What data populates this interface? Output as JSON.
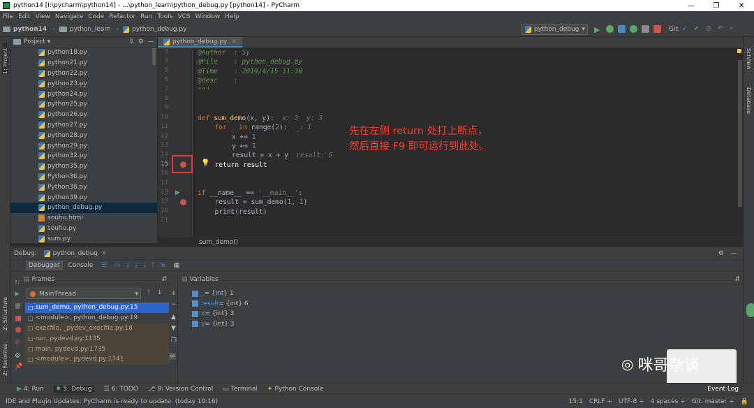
{
  "window": {
    "title": "python14 [I:\\pycharm\\python14] - ...\\python_learn\\python_debug.py [python14] - PyCharm",
    "minimize": "—",
    "maximize": "❐",
    "close": "✕"
  },
  "menu": [
    "File",
    "Edit",
    "View",
    "Navigate",
    "Code",
    "Refactor",
    "Run",
    "Tools",
    "VCS",
    "Window",
    "Help"
  ],
  "breadcrumbs": [
    "python14",
    "python_learn",
    "python_debug.py"
  ],
  "run_config": "python_debug",
  "git_label": "Git:",
  "left_strip": {
    "project": "1: Project",
    "structure": "Z: Structure",
    "favorites": "2: Favorites"
  },
  "right_strip": {
    "sciview": "SciView",
    "database": "Database"
  },
  "project_panel": {
    "title": "Project",
    "files": [
      "python18.py",
      "python21.py",
      "python22.py",
      "python23.py",
      "python24.py",
      "python25.py",
      "python26.py",
      "python27.py",
      "python28.py",
      "python29.py",
      "python32.py",
      "python35.py",
      "Python36.py",
      "Python38.py",
      "python39.py",
      "python_debug.py",
      "souhu.html",
      "souhu.py",
      "sum.py"
    ]
  },
  "editor": {
    "tab": "python_debug.py",
    "line_numbers": [
      "3",
      "4",
      "5",
      "6",
      "7",
      "8",
      "9",
      "10",
      "11",
      "12",
      "13",
      "14",
      "15",
      "16",
      "17",
      "18",
      "19",
      "20",
      "21"
    ],
    "breadcrumb": "sum_demo()",
    "code": {
      "l3_key": "@Author",
      "l3_val": "  : Sy",
      "l4_key": "@File",
      "l4_val": "    : python_debug.py",
      "l5_key": "@Time",
      "l5_val": "    : 2019/4/15 11:30",
      "l6_key": "@desc",
      "l6_val": "    :",
      "l7": "\"\"\"",
      "l10_def": "def ",
      "l10_fn": "sum_demo",
      "l10_args": "(x, y):",
      "l10_inline": "  x: 3  y: 3",
      "l11_for": "for ",
      "l11_mid": "_ ",
      "l11_in": "in ",
      "l11_range": "range(",
      "l11_num": "2",
      "l11_end": "):",
      "l11_inline": "  _: 1",
      "l12_a": "x += ",
      "l12_num": "1",
      "l13_a": "y += ",
      "l13_num": "1",
      "l14_a": "result = x + y",
      "l14_inline": "  result: 6",
      "l15_kw": "return ",
      "l15_rest": "result",
      "l18_if": "if ",
      "l18_mid": "__name__ == ",
      "l18_str": "'__main__'",
      "l18_end": ":",
      "l19_a": "result = sum_demo(",
      "l19_n1": "1",
      "l19_sep": ", ",
      "l19_n2": "1",
      "l19_end": ")",
      "l20": "print(result)"
    }
  },
  "annotation": {
    "line1": "先在左侧 return 处打上断点，",
    "line2": "然后直接 F9 即可运行到此处。"
  },
  "debug": {
    "label": "Debug:",
    "config": "python_debug",
    "tabs": [
      "Debugger",
      "Console"
    ],
    "frames_title": "Frames",
    "thread": "MainThread",
    "frames": [
      {
        "text": "sum_demo, python_debug.py:15",
        "kind": "sel"
      },
      {
        "text": "<module>, python_debug.py:19",
        "kind": "user"
      },
      {
        "text": "execfile, _pydev_execfile.py:18",
        "kind": "lib"
      },
      {
        "text": "run, pydevd.py:1135",
        "kind": "lib"
      },
      {
        "text": "main, pydevd.py:1735",
        "kind": "lib"
      },
      {
        "text": "<module>, pydevd.py:1741",
        "kind": "lib"
      }
    ],
    "variables_title": "Variables",
    "variables": [
      {
        "name": "_",
        "value": " = {int} 1"
      },
      {
        "name": "result",
        "value": " = {int} 6"
      },
      {
        "name": "x",
        "value": " = {int} 3"
      },
      {
        "name": "y",
        "value": " = {int} 3"
      }
    ]
  },
  "bottom_tabs": [
    "4: Run",
    "5: Debug",
    "6: TODO",
    "9: Version Control",
    "Terminal",
    "Python Console"
  ],
  "event_log": "Event Log",
  "status": {
    "message": "IDE and Plugin Updates: PyCharm is ready to update. (today 10:16)",
    "position": "15:1",
    "line_sep": "CRLF ÷",
    "encoding": "UTF-8 ÷",
    "indent": "4 spaces ÷",
    "git": "Git: master ÷"
  },
  "watermark": "咪哥杂谈",
  "colors": {
    "accent": "#4a88c7",
    "breakpoint": "#c75450",
    "selection": "#2d6099",
    "annotation": "#ff3b30"
  }
}
